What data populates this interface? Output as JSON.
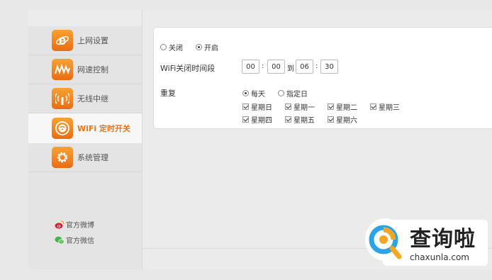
{
  "nav": {
    "items": [
      {
        "label": "上网设置",
        "icon": "internet-explorer-icon",
        "active": false
      },
      {
        "label": "网速控制",
        "icon": "speed-wave-icon",
        "active": false
      },
      {
        "label": "无线中继",
        "icon": "wireless-relay-icon",
        "active": false
      },
      {
        "label": "WiFi 定时开关",
        "icon": "wifi-timer-icon",
        "active": true
      },
      {
        "label": "系统管理",
        "icon": "gear-icon",
        "active": false
      }
    ],
    "social": [
      {
        "label": "官方微博",
        "icon": "weibo-icon"
      },
      {
        "label": "官方微信",
        "icon": "wechat-icon"
      }
    ]
  },
  "wifi_timer": {
    "power": {
      "off_label": "关闭",
      "on_label": "开启",
      "selected": "on"
    },
    "period": {
      "label": "WiFi关闭时间段",
      "start_hour": "00",
      "start_minute": "00",
      "to_label": "到",
      "end_hour": "06",
      "end_minute": "30",
      "colon": ":"
    },
    "repeat": {
      "label": "重复",
      "daily_label": "每天",
      "custom_label": "指定日",
      "selected": "daily",
      "days": [
        "星期日",
        "星期一",
        "星期二",
        "星期三",
        "星期四",
        "星期五",
        "星期六"
      ],
      "checked": [
        true,
        true,
        true,
        true,
        true,
        true,
        true
      ]
    }
  },
  "watermark": {
    "title": "查询啦",
    "url": "chaxunla.com"
  },
  "colors": {
    "accent": "#e8731a",
    "icon_bg": "#f08a24"
  }
}
